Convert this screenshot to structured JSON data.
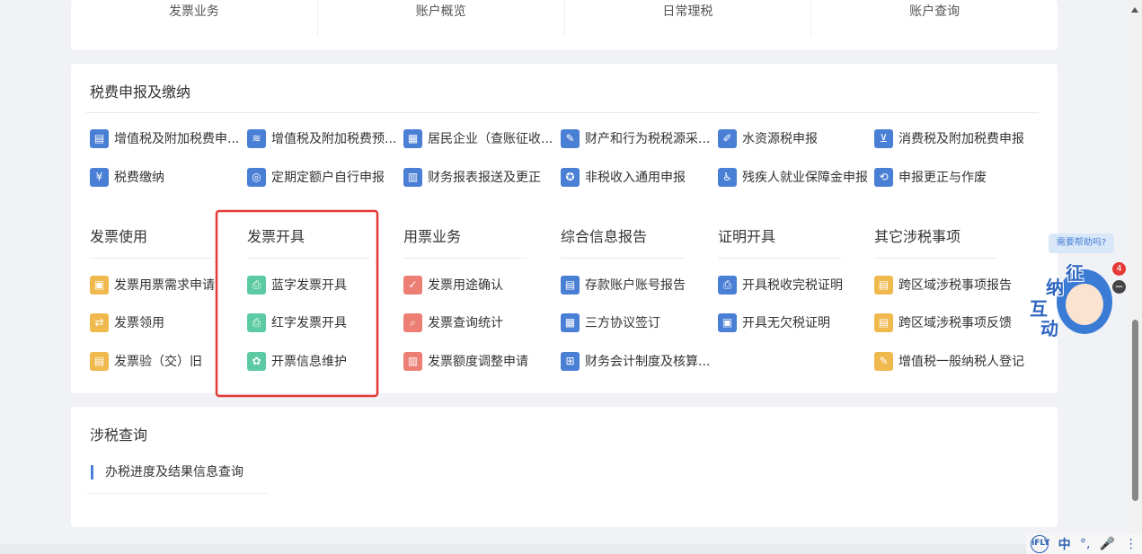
{
  "top_tabs": [
    "发票业务",
    "账户概览",
    "日常理税",
    "账户查询"
  ],
  "declaration": {
    "title": "税费申报及缴纳",
    "row1": [
      {
        "label": "增值税及附加税费申...",
        "icon": "document-icon"
      },
      {
        "label": "增值税及附加税费预...",
        "icon": "layers-icon"
      },
      {
        "label": "居民企业（查账征收...",
        "icon": "calendar-icon"
      },
      {
        "label": "财产和行为税税源采...",
        "icon": "edit-document-icon"
      },
      {
        "label": "水资源税申报",
        "icon": "water-document-icon"
      },
      {
        "label": "消费税及附加税费申报",
        "icon": "basket-icon"
      }
    ],
    "row2": [
      {
        "label": "税费缴纳",
        "icon": "coin-icon"
      },
      {
        "label": "定期定额户自行申报",
        "icon": "target-document-icon"
      },
      {
        "label": "财务报表报送及更正",
        "icon": "report-icon"
      },
      {
        "label": "非税收入通用申报",
        "icon": "medal-icon"
      },
      {
        "label": "残疾人就业保障金申报",
        "icon": "wheelchair-icon"
      },
      {
        "label": "申报更正与作废",
        "icon": "correction-icon"
      }
    ]
  },
  "categories": [
    {
      "title": "发票使用",
      "items": [
        "发票用票需求申请",
        "发票领用",
        "发票验（交）旧"
      ]
    },
    {
      "title": "发票开具",
      "items": [
        "蓝字发票开具",
        "红字发票开具",
        "开票信息维护"
      ]
    },
    {
      "title": "用票业务",
      "items": [
        "发票用途确认",
        "发票查询统计",
        "发票额度调整申请"
      ]
    },
    {
      "title": "综合信息报告",
      "items": [
        "存款账户账号报告",
        "三方协议签订",
        "财务会计制度及核算..."
      ]
    },
    {
      "title": "证明开具",
      "items": [
        "开具税收完税证明",
        "开具无欠税证明"
      ]
    },
    {
      "title": "其它涉税事项",
      "items": [
        "跨区域涉税事项报告",
        "跨区域涉税事项反馈",
        "增值税一般纳税人登记"
      ]
    }
  ],
  "query": {
    "title": "涉税查询",
    "items": [
      "办税进度及结果信息查询"
    ]
  },
  "assistant": {
    "bubble": "需要帮助吗?",
    "chars": [
      "征",
      "纳",
      "互",
      "动"
    ],
    "badge_count": "4",
    "minus": "−"
  },
  "ime": [
    "iFLY",
    "中",
    "°,",
    "🎤",
    "⋮"
  ],
  "colors": {
    "accent_blue": "#4a7fd6",
    "highlight_red": "#e53935"
  }
}
